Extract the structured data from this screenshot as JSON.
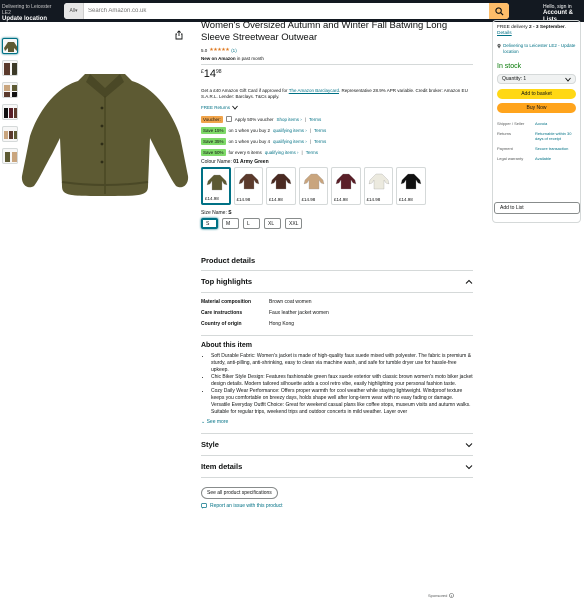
{
  "nav": {
    "deliver_line1": "Delivering to Leicester LE2",
    "deliver_line2": "Update location",
    "search_category": "All",
    "search_placeholder": "Search Amazon.co.uk",
    "account_line1": "Hello, sign in",
    "account_line2": "Account & Lists"
  },
  "product": {
    "title": "Women's Oversized Autumn and Winter Fall Batwing Long Sleeve Streetwear Outwear",
    "rating_value": "5.0",
    "rating_stars": "★★★★★",
    "rating_count": "(1)",
    "new_on_bold": "New on Amazon",
    "new_on_rest": "in past month",
    "price_symbol": "£",
    "price_whole": "14",
    "price_fraction": "98",
    "gift_pre": "Get a £40 Amazon Gift Card if approved for ",
    "gift_link": "The Amazon Barclaycard",
    "gift_post": ". Representative 28.9% APR variable. Credit broker: Amazon EU S.A.R.L. Lender: Barclays. T&Cs apply.",
    "returns": "FREE Returns"
  },
  "promos": [
    {
      "tag": "Voucher:",
      "text": "Apply 50% voucher",
      "link": "Shop items ›",
      "terms": "Terms"
    },
    {
      "tag": "Save 15%",
      "text": "on 1 when you buy 2",
      "link": "qualifying items ›",
      "terms": "Terms"
    },
    {
      "tag": "Save 35%",
      "text": "on 1 when you buy 4",
      "link": "qualifying items ›",
      "terms": "Terms"
    },
    {
      "tag": "Save 50%",
      "text": "for every 6 items",
      "link": "qualifying items ›",
      "terms": "Terms"
    }
  ],
  "colour": {
    "label": "Colour Name:",
    "selected": "01 Army Green",
    "swatches": [
      {
        "price": "£14.98",
        "color": "#5d5a33"
      },
      {
        "price": "£14.98",
        "color": "#5b3a2c"
      },
      {
        "price": "£14.98",
        "color": "#4a2a22"
      },
      {
        "price": "£14.98",
        "color": "#c9a57e"
      },
      {
        "price": "£14.98",
        "color": "#5a1f28"
      },
      {
        "price": "£14.98",
        "color": "#eceadf"
      },
      {
        "price": "£14.98",
        "color": "#111111"
      }
    ]
  },
  "size": {
    "label": "Size Name:",
    "selected": "S",
    "options": [
      "S",
      "M",
      "L",
      "XL",
      "XXL"
    ]
  },
  "details": {
    "product_details": "Product details",
    "top_highlights": "Top highlights",
    "attributes": [
      {
        "k": "Material composition",
        "v": "Brown coat women"
      },
      {
        "k": "Care instructions",
        "v": "Faux leather jacket women"
      },
      {
        "k": "Country of origin",
        "v": "Hong Kong"
      }
    ],
    "about_title": "About this item",
    "about_items": [
      "Soft Durable Fabric: Women's jacket is made of high-quality faux suede mixed with polyester. The fabric is premium & sturdy, anti-pilling, anti-shrinking, easy to clean via machine wash, and safe for tumble dryer use for hassle-free upkeep.",
      "Chic Biker Style Design: Features fashionable green faux suede exterior with classic brown women's moto biker jacket design details. Modern tailored silhouette adds a cool retro vibe, easily highlighting your personal fashion taste.",
      "Cozy Daily Wear Performance: Offers proper warmth for cool weather while staying lightweight. Windproof texture keeps you comfortable on breezy days, holds shape well after long-term wear with no easy fading or damage.",
      "Versatile Everyday Outfit Choice: Great for weekend casual plans like coffee stops, museum visits and autumn walks. Suitable for regular trips, weekend trips and outdoor concerts in mild weather. Layer over"
    ],
    "see_more": "See more",
    "style": "Style",
    "item_details": "Item details",
    "see_all_specs": "See all product specifications",
    "report": "Report an issue with this product"
  },
  "buybox": {
    "partial_top": "FREE Returns",
    "delivery_pre": "FREE delivery ",
    "delivery_date": "2 - 3 September",
    "delivery_link": "Details",
    "location": "Delivering to Leicester LE2 - Update location",
    "in_stock": "In stock",
    "quantity": "Quantity: 1",
    "add_to_basket": "Add to basket",
    "buy_now": "Buy Now",
    "info": [
      {
        "k": "Shipper / Seller",
        "v": "Aovoia"
      },
      {
        "k": "Returns",
        "v": "Returnable within 30 days of receipt"
      },
      {
        "k": "Payment",
        "v": "Secure transaction"
      },
      {
        "k": "Legal warranty",
        "v": "Available"
      }
    ],
    "add_to_list": "Add to List"
  },
  "sponsored": "Sponsored"
}
